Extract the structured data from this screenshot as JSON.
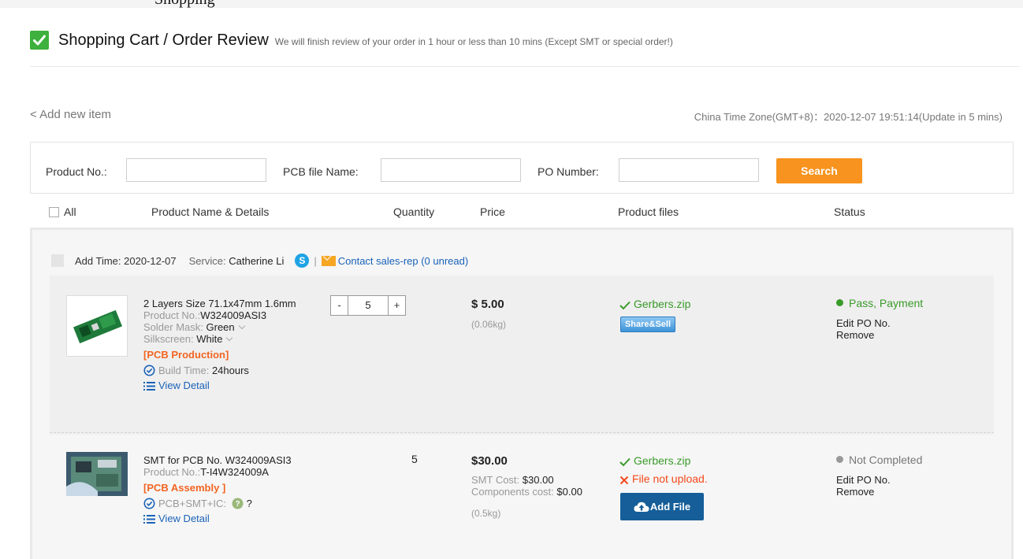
{
  "partial_heading": "Shopping",
  "header": {
    "title": "Shopping Cart / Order Review",
    "subtitle": "We will finish review of your order in 1 hour or less than 10 mins (Except SMT or special order!)"
  },
  "add_new_item": "< Add new item",
  "timezone_text": "China Time Zone(GMT+8)：2020-12-07 19:51:14(Update in 5 mins)",
  "search": {
    "product_no_label": "Product No.:",
    "pcb_file_label": "PCB file Name:",
    "po_number_label": "PO Number:",
    "button_label": "Search"
  },
  "columns": {
    "all": "All",
    "product": "Product Name & Details",
    "quantity": "Quantity",
    "price": "Price",
    "files": "Product files",
    "status": "Status"
  },
  "order": {
    "add_time": "Add Time: 2020-12-07",
    "service_label": "Service:",
    "service_name": "Catherine Li",
    "contact": "Contact sales-rep (0 unread)"
  },
  "items": [
    {
      "title": "2 Layers Size 71.1x47mm 1.6mm",
      "product_no_label": "Product No.:",
      "product_no": "W324009ASI3",
      "solder_label": "Solder Mask:",
      "solder_value": "Green",
      "silk_label": "Silkscreen:",
      "silk_value": "White",
      "category": "[PCB Production]",
      "build_label": "Build Time:",
      "build_value": "24hours",
      "view_detail": "View Detail",
      "qty_minus": "-",
      "qty_value": "5",
      "qty_plus": "+",
      "price": "$ 5.00",
      "weight": "(0.06kg)",
      "file": "Gerbers.zip",
      "share_button": "Share&Sell",
      "status": "Pass, Payment",
      "status_color": "#3a9a2a",
      "edit_po": "Edit PO No.",
      "remove": "Remove"
    },
    {
      "title": "SMT for PCB No. W324009ASI3",
      "product_no_label": "Product No.:",
      "product_no": "T-I4W324009A",
      "category": "[PCB Assembly ]",
      "type_label": "PCB+SMT+IC:",
      "type_value": "?",
      "view_detail": "View Detail",
      "qty_value": "5",
      "price": "$30.00",
      "smt_cost_label": "SMT Cost:",
      "smt_cost": "$30.00",
      "components_label": "Components cost:",
      "components_cost": "$0.00",
      "weight": "(0.5kg)",
      "file": "Gerbers.zip",
      "file_error": "File not upload.",
      "add_file_button": "Add File",
      "status": "Not Completed",
      "status_color": "#999999",
      "edit_po": "Edit PO No.",
      "remove": "Remove"
    }
  ],
  "colors": {
    "accent_orange": "#f7931e",
    "link_blue": "#1a62b8",
    "success_green": "#3a9a2a",
    "error_red": "#f5481b",
    "add_file_blue": "#155e99"
  }
}
